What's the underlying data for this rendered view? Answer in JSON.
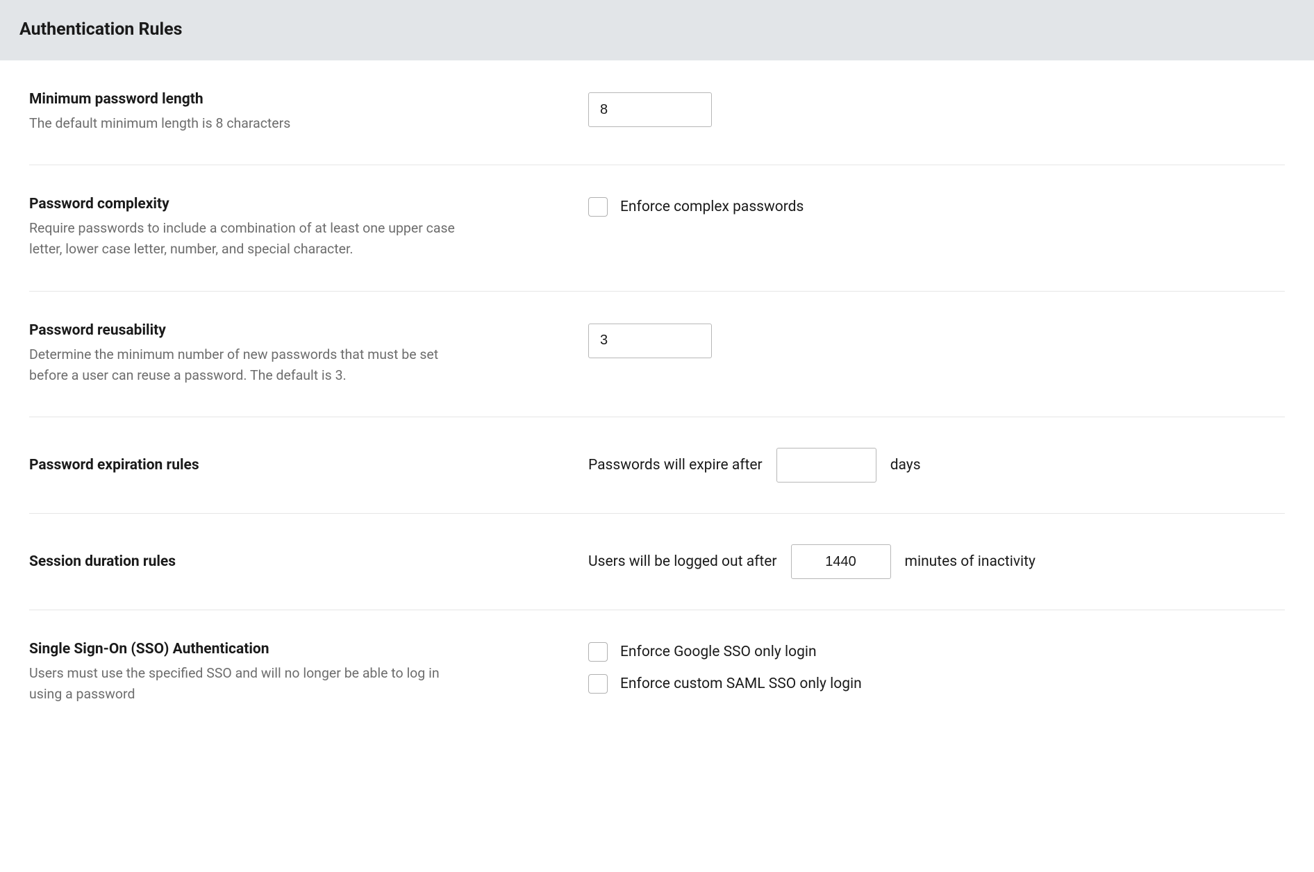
{
  "header": {
    "title": "Authentication Rules"
  },
  "rows": {
    "min_pwd_length": {
      "title": "Minimum password length",
      "desc": "The default minimum length is 8 characters",
      "value": "8"
    },
    "pwd_complexity": {
      "title": "Password complexity",
      "desc": "Require passwords to include a combination of at least one upper case letter, lower case letter, number, and special character.",
      "checkbox_label": "Enforce complex passwords",
      "checked": false
    },
    "pwd_reuse": {
      "title": "Password reusability",
      "desc": "Determine the minimum number of new passwords that must be set before a user can reuse a password. The default is 3.",
      "value": "3"
    },
    "pwd_expire": {
      "title": "Password expiration rules",
      "prefix": "Passwords will expire after",
      "value": "",
      "suffix": "days"
    },
    "session": {
      "title": "Session duration rules",
      "prefix": "Users will be logged out after",
      "value": "1440",
      "suffix": "minutes of inactivity"
    },
    "sso": {
      "title": "Single Sign-On (SSO) Authentication",
      "desc": "Users must use the specified SSO and will no longer be able to log in using a password",
      "options": [
        {
          "label": "Enforce Google SSO only login",
          "checked": false
        },
        {
          "label": "Enforce custom SAML SSO only login",
          "checked": false
        }
      ]
    }
  }
}
